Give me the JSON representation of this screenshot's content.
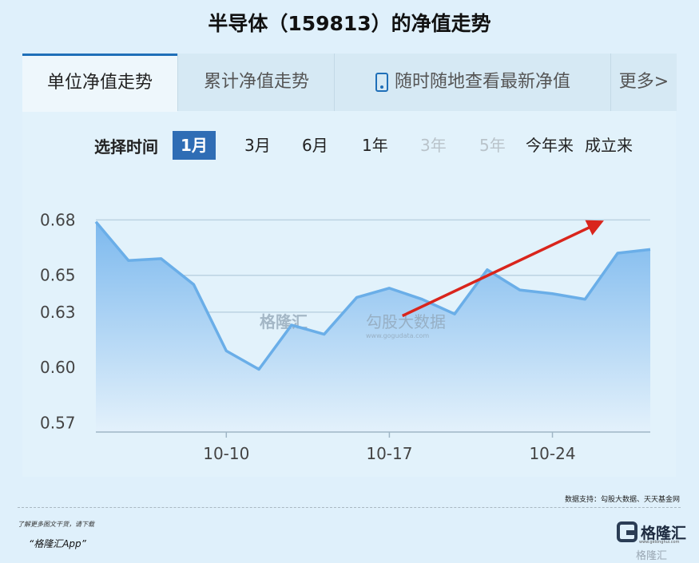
{
  "title": "半导体（159813）的净值走势",
  "tabs": [
    {
      "label": "单位净值走势",
      "active": true
    },
    {
      "label": "累计净值走势",
      "active": false
    },
    {
      "label": "随时随地查看最新净值",
      "icon": "phone-icon",
      "active": false
    },
    {
      "label": "更多>",
      "active": false
    }
  ],
  "range": {
    "label": "选择时间",
    "options": [
      {
        "label": "1月",
        "state": "selected"
      },
      {
        "label": "3月",
        "state": "normal"
      },
      {
        "label": "6月",
        "state": "normal"
      },
      {
        "label": "1年",
        "state": "normal"
      },
      {
        "label": "3年",
        "state": "disabled"
      },
      {
        "label": "5年",
        "state": "disabled"
      },
      {
        "label": "今年来",
        "state": "normal"
      },
      {
        "label": "成立来",
        "state": "normal"
      }
    ]
  },
  "watermark": {
    "brand": "格隆汇",
    "sub": "勾股大数据",
    "url": "www.gogudata.com"
  },
  "chart_data": {
    "type": "area",
    "y_ticks": [
      0.68,
      0.65,
      0.63,
      0.6,
      0.57
    ],
    "ylim": [
      0.565,
      0.691
    ],
    "x_ticks": [
      {
        "label": "10-10",
        "index": 4
      },
      {
        "label": "10-17",
        "index": 9
      },
      {
        "label": "10-24",
        "index": 14
      }
    ],
    "series": [
      {
        "values": [
          0.679,
          0.658,
          0.659,
          0.645,
          0.609,
          0.599,
          0.623,
          0.618,
          0.638,
          0.643,
          0.637,
          0.629,
          0.653,
          0.642,
          0.64,
          0.637,
          0.662,
          0.664
        ]
      }
    ],
    "annotation": {
      "type": "trend-arrow",
      "from": [
        9.4,
        0.628
      ],
      "to": [
        15.5,
        0.679
      ],
      "color": "#d9251c"
    },
    "colors": {
      "line": "#6aaee8",
      "fill_top": "#7db9ee",
      "fill_bottom": "#e3f1fb",
      "grid": "#bcd3e2"
    }
  },
  "footer": {
    "source": "数据支持：勾股大数据、天天基金网",
    "note1": "了解更多图文干货，请下载",
    "note2": "“格隆汇App”",
    "logo": "格隆汇",
    "logo_sub": "www.gelonghui.com",
    "watermark": "格隆汇"
  }
}
